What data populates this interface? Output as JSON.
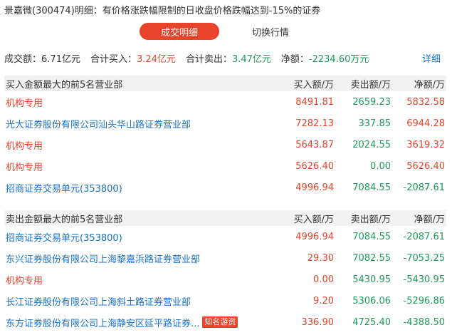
{
  "title": "景嘉微(300474)明细：有价格涨跌幅限制的日收盘价格跌幅达到-15%的证券",
  "tabs": {
    "active": "成交明细",
    "other": "切换行情"
  },
  "summary": {
    "turnover_label": "成交额：",
    "turnover": "6.71亿元",
    "buy_label": "合计买入：",
    "buy": "3.24亿元",
    "sell_label": "合计卖出：",
    "sell": "3.47亿元",
    "net_label": "净额：",
    "net": "-2234.60万元",
    "detail_link": "详细"
  },
  "columns": {
    "buy": "买入额/万",
    "sell": "卖出额/万",
    "net": "净额/万"
  },
  "buy_section": {
    "header": "买入金额最大的前5名营业部",
    "rows": [
      {
        "name": "机构专用",
        "buy": "8491.81",
        "sell": "2659.23",
        "net": "5832.58"
      },
      {
        "name": "光大证券股份有限公司汕头华山路证券营业部",
        "buy": "7282.13",
        "sell": "337.85",
        "net": "6944.28"
      },
      {
        "name": "机构专用",
        "buy": "5643.87",
        "sell": "2024.55",
        "net": "3619.32"
      },
      {
        "name": "机构专用",
        "buy": "5626.40",
        "sell": "0.00",
        "net": "5626.40"
      },
      {
        "name": "招商证券交易单元(353800)",
        "buy": "4996.94",
        "sell": "7084.55",
        "net": "-2087.61"
      }
    ]
  },
  "sell_section": {
    "header": "卖出金额最大的前5名营业部",
    "rows": [
      {
        "name": "招商证券交易单元(353800)",
        "buy": "4996.94",
        "sell": "7084.55",
        "net": "-2087.61"
      },
      {
        "name": "东兴证券股份有限公司上海黎嘉浜路证券营业部",
        "buy": "29.30",
        "sell": "7082.55",
        "net": "-7053.25"
      },
      {
        "name": "机构专用",
        "buy": "0.00",
        "sell": "5430.95",
        "net": "-5430.95"
      },
      {
        "name": "长江证券股份有限公司上海斜土路证券营业部",
        "buy": "9.20",
        "sell": "5306.06",
        "net": "-5296.86"
      },
      {
        "name": "东方证券股份有限公司上海静安区延平路证券...",
        "badge": "知名游资",
        "buy": "336.90",
        "sell": "4725.40",
        "net": "-4388.50"
      }
    ]
  },
  "colors": {
    "red": "#e9432b",
    "green": "#1e9b5b",
    "blue": "#1a73c8",
    "header_bg": "#f2f2f2"
  }
}
